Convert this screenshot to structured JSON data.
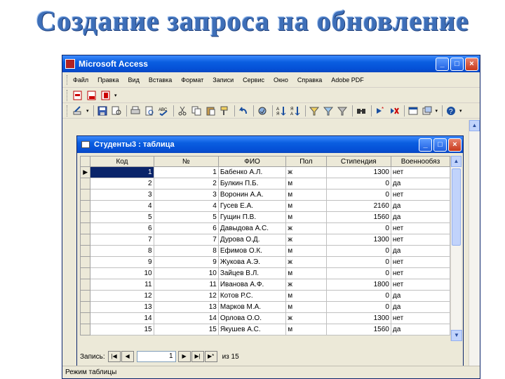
{
  "slide": {
    "title": "Создание запроса на обновление"
  },
  "app": {
    "title": "Microsoft Access",
    "window_buttons": [
      "_",
      "□",
      "×"
    ]
  },
  "menu": [
    "Файл",
    "Правка",
    "Вид",
    "Вставка",
    "Формат",
    "Записи",
    "Сервис",
    "Окно",
    "Справка",
    "Adobe PDF"
  ],
  "toolbar1_icons": [
    "pdf-convert-icon",
    "pdf-email-icon",
    "pdf-review-icon"
  ],
  "toolbar2_icons": [
    "design-view-icon",
    "save-icon",
    "print-icon",
    "print-preview-icon",
    "spelling-icon",
    "cut-icon",
    "copy-icon",
    "paste-icon",
    "undo-icon",
    "hyperlink-icon",
    "sort-ascending-icon",
    "sort-descending-icon",
    "filter-by-selection-icon",
    "filter-by-form-icon",
    "apply-filter-icon",
    "find-icon",
    "new-record-icon",
    "delete-record-icon",
    "database-window-icon",
    "new-object-icon",
    "help-icon"
  ],
  "table_window": {
    "title": "Студенты3 : таблица",
    "columns": [
      "Код",
      "№",
      "ФИО",
      "Пол",
      "Стипендия",
      "Военнообяз"
    ],
    "rows": [
      [
        "1",
        "1",
        "Бабенко А.Л.",
        "ж",
        "1300",
        "нет"
      ],
      [
        "2",
        "2",
        "Булкин П.Б.",
        "м",
        "0",
        "да"
      ],
      [
        "3",
        "3",
        "Воронин А.А.",
        "м",
        "0",
        "нет"
      ],
      [
        "4",
        "4",
        "Гусев Е.А.",
        "м",
        "2160",
        "да"
      ],
      [
        "5",
        "5",
        "Гущин П.В.",
        "м",
        "1560",
        "да"
      ],
      [
        "6",
        "6",
        "Давыдова А.С.",
        "ж",
        "0",
        "нет"
      ],
      [
        "7",
        "7",
        "Дурова О.Д.",
        "ж",
        "1300",
        "нет"
      ],
      [
        "8",
        "8",
        "Ефимов О.К.",
        "м",
        "0",
        "да"
      ],
      [
        "9",
        "9",
        "Жукова А.Э.",
        "ж",
        "0",
        "нет"
      ],
      [
        "10",
        "10",
        "Зайцев В.Л.",
        "м",
        "0",
        "нет"
      ],
      [
        "11",
        "11",
        "Иванова А.Ф.",
        "ж",
        "1800",
        "нет"
      ],
      [
        "12",
        "12",
        "Котов Р.С.",
        "м",
        "0",
        "да"
      ],
      [
        "13",
        "13",
        "Марков М.А.",
        "м",
        "0",
        "да"
      ],
      [
        "14",
        "14",
        "Орлова О.О.",
        "ж",
        "1300",
        "нет"
      ],
      [
        "15",
        "15",
        "Якушев А.С.",
        "м",
        "1560",
        "да"
      ]
    ],
    "current_row_marker": "▶"
  },
  "navigation": {
    "label": "Запись:",
    "current": "1",
    "total_label": "из 15",
    "buttons": [
      "|◀",
      "◀",
      "▶",
      "▶|",
      "▶*"
    ]
  },
  "status": {
    "text": "Режим таблицы"
  }
}
